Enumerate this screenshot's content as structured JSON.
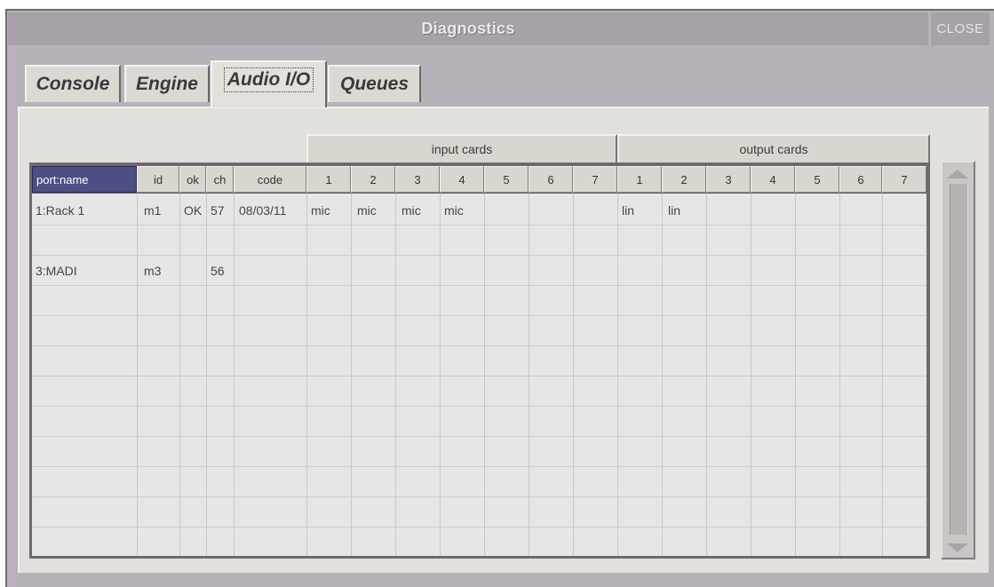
{
  "window": {
    "title": "Diagnostics",
    "close_label": "CLOSE"
  },
  "tabs": [
    {
      "label": "Console"
    },
    {
      "label": "Engine"
    },
    {
      "label": "Audio I/O",
      "active": true
    },
    {
      "label": "Queues"
    }
  ],
  "groups": {
    "input": "input cards",
    "output": "output cards"
  },
  "columns": [
    "port:name",
    "id",
    "ok",
    "ch",
    "code",
    "1",
    "2",
    "3",
    "4",
    "5",
    "6",
    "7",
    "1",
    "2",
    "3",
    "4",
    "5",
    "6",
    "7"
  ],
  "rows": [
    {
      "port_name": "1:Rack 1",
      "id": "m1",
      "ok": "OK",
      "ch": "57",
      "code": "08/03/11",
      "in1": "mic",
      "in2": "mic",
      "in3": "mic",
      "in4": "mic",
      "out1": "lin",
      "out2": "lin"
    },
    {
      "port_name": "3:MADI",
      "id": "m3",
      "ok": "",
      "ch": "56"
    }
  ],
  "colors": {
    "selected_header": "#4d4e82",
    "window_bg": "#b8b1b9",
    "grid_bg": "#e7e6e6"
  },
  "icons": {
    "scroll_up": "triangle-up",
    "scroll_down": "triangle-down"
  }
}
